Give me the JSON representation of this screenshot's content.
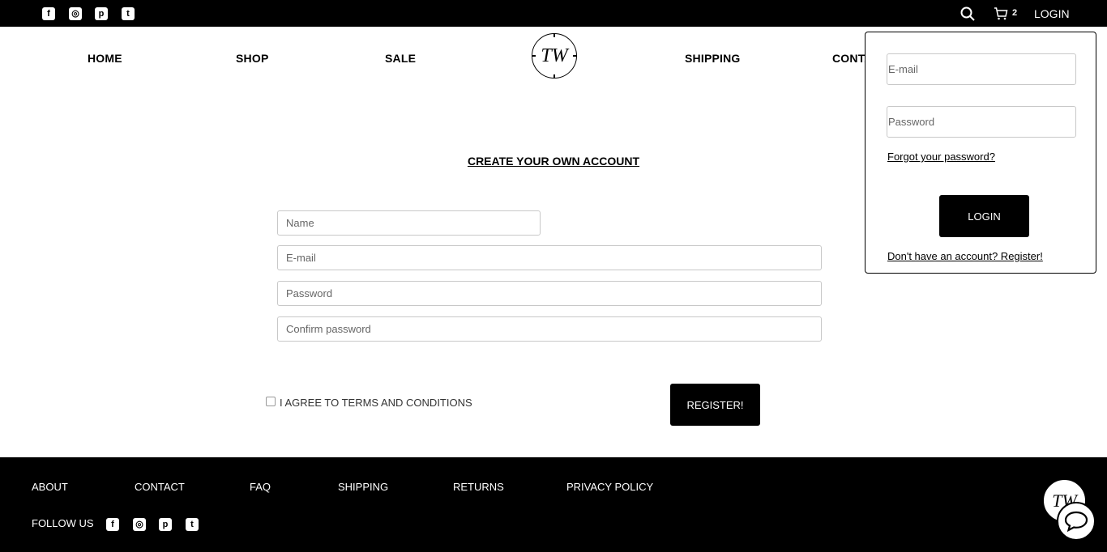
{
  "topbar": {
    "social": [
      {
        "icon": "facebook-icon",
        "glyph": "f"
      },
      {
        "icon": "instagram-icon",
        "glyph": "◎"
      },
      {
        "icon": "pinterest-icon",
        "glyph": "p"
      },
      {
        "icon": "twitter-icon",
        "glyph": "t"
      }
    ],
    "cart_count": "2",
    "login_label": "LOGIN"
  },
  "nav": {
    "items": [
      "HOME",
      "SHOP",
      "SALE",
      "SHIPPING",
      "CONTA"
    ],
    "logo_text": "TW"
  },
  "register": {
    "title": "CREATE YOUR OWN ACCOUNT",
    "name_placeholder": "Name",
    "email_placeholder": "E-mail",
    "password_placeholder": "Password",
    "confirm_placeholder": "Confirm password",
    "agree_label": "I AGREE TO TERMS AND CONDITIONS",
    "button_label": "REGISTER!"
  },
  "login_panel": {
    "email_placeholder": "E-mail",
    "password_placeholder": "Password",
    "forgot_label": "Forgot your password?",
    "button_label": "LOGIN",
    "register_label": "Don't have an account? Register!"
  },
  "footer": {
    "links": [
      "ABOUT",
      "CONTACT",
      "FAQ",
      "SHIPPING",
      "RETURNS",
      "PRIVACY POLICY"
    ],
    "follow_label": "FOLLOW US",
    "logo_text": "TW"
  },
  "colors": {
    "primary": "#000000",
    "background": "#ffffff",
    "border": "#c8c8c8"
  }
}
